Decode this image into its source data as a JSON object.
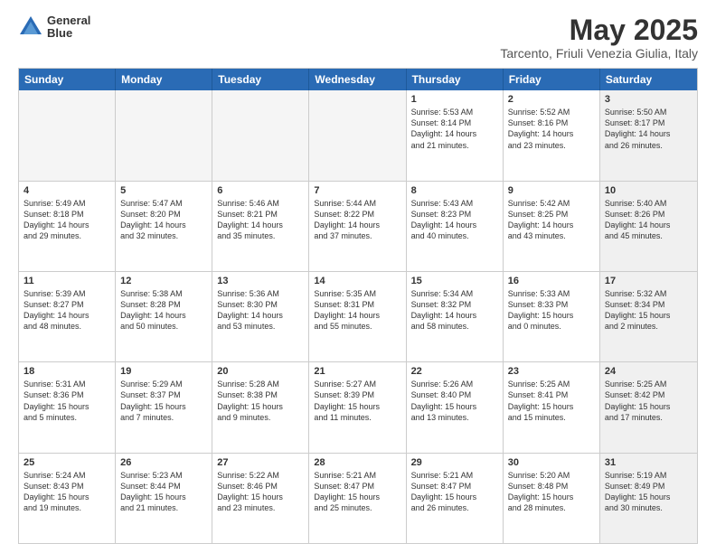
{
  "logo": {
    "line1": "General",
    "line2": "Blue"
  },
  "title": {
    "month": "May 2025",
    "location": "Tarcento, Friuli Venezia Giulia, Italy"
  },
  "header_days": [
    "Sunday",
    "Monday",
    "Tuesday",
    "Wednesday",
    "Thursday",
    "Friday",
    "Saturday"
  ],
  "weeks": [
    [
      {
        "day": "",
        "info": "",
        "empty": true
      },
      {
        "day": "",
        "info": "",
        "empty": true
      },
      {
        "day": "",
        "info": "",
        "empty": true
      },
      {
        "day": "",
        "info": "",
        "empty": true
      },
      {
        "day": "1",
        "info": "Sunrise: 5:53 AM\nSunset: 8:14 PM\nDaylight: 14 hours\nand 21 minutes.",
        "empty": false
      },
      {
        "day": "2",
        "info": "Sunrise: 5:52 AM\nSunset: 8:16 PM\nDaylight: 14 hours\nand 23 minutes.",
        "empty": false
      },
      {
        "day": "3",
        "info": "Sunrise: 5:50 AM\nSunset: 8:17 PM\nDaylight: 14 hours\nand 26 minutes.",
        "empty": false,
        "shaded": true
      }
    ],
    [
      {
        "day": "4",
        "info": "Sunrise: 5:49 AM\nSunset: 8:18 PM\nDaylight: 14 hours\nand 29 minutes.",
        "empty": false
      },
      {
        "day": "5",
        "info": "Sunrise: 5:47 AM\nSunset: 8:20 PM\nDaylight: 14 hours\nand 32 minutes.",
        "empty": false
      },
      {
        "day": "6",
        "info": "Sunrise: 5:46 AM\nSunset: 8:21 PM\nDaylight: 14 hours\nand 35 minutes.",
        "empty": false
      },
      {
        "day": "7",
        "info": "Sunrise: 5:44 AM\nSunset: 8:22 PM\nDaylight: 14 hours\nand 37 minutes.",
        "empty": false
      },
      {
        "day": "8",
        "info": "Sunrise: 5:43 AM\nSunset: 8:23 PM\nDaylight: 14 hours\nand 40 minutes.",
        "empty": false
      },
      {
        "day": "9",
        "info": "Sunrise: 5:42 AM\nSunset: 8:25 PM\nDaylight: 14 hours\nand 43 minutes.",
        "empty": false
      },
      {
        "day": "10",
        "info": "Sunrise: 5:40 AM\nSunset: 8:26 PM\nDaylight: 14 hours\nand 45 minutes.",
        "empty": false,
        "shaded": true
      }
    ],
    [
      {
        "day": "11",
        "info": "Sunrise: 5:39 AM\nSunset: 8:27 PM\nDaylight: 14 hours\nand 48 minutes.",
        "empty": false
      },
      {
        "day": "12",
        "info": "Sunrise: 5:38 AM\nSunset: 8:28 PM\nDaylight: 14 hours\nand 50 minutes.",
        "empty": false
      },
      {
        "day": "13",
        "info": "Sunrise: 5:36 AM\nSunset: 8:30 PM\nDaylight: 14 hours\nand 53 minutes.",
        "empty": false
      },
      {
        "day": "14",
        "info": "Sunrise: 5:35 AM\nSunset: 8:31 PM\nDaylight: 14 hours\nand 55 minutes.",
        "empty": false
      },
      {
        "day": "15",
        "info": "Sunrise: 5:34 AM\nSunset: 8:32 PM\nDaylight: 14 hours\nand 58 minutes.",
        "empty": false
      },
      {
        "day": "16",
        "info": "Sunrise: 5:33 AM\nSunset: 8:33 PM\nDaylight: 15 hours\nand 0 minutes.",
        "empty": false
      },
      {
        "day": "17",
        "info": "Sunrise: 5:32 AM\nSunset: 8:34 PM\nDaylight: 15 hours\nand 2 minutes.",
        "empty": false,
        "shaded": true
      }
    ],
    [
      {
        "day": "18",
        "info": "Sunrise: 5:31 AM\nSunset: 8:36 PM\nDaylight: 15 hours\nand 5 minutes.",
        "empty": false
      },
      {
        "day": "19",
        "info": "Sunrise: 5:29 AM\nSunset: 8:37 PM\nDaylight: 15 hours\nand 7 minutes.",
        "empty": false
      },
      {
        "day": "20",
        "info": "Sunrise: 5:28 AM\nSunset: 8:38 PM\nDaylight: 15 hours\nand 9 minutes.",
        "empty": false
      },
      {
        "day": "21",
        "info": "Sunrise: 5:27 AM\nSunset: 8:39 PM\nDaylight: 15 hours\nand 11 minutes.",
        "empty": false
      },
      {
        "day": "22",
        "info": "Sunrise: 5:26 AM\nSunset: 8:40 PM\nDaylight: 15 hours\nand 13 minutes.",
        "empty": false
      },
      {
        "day": "23",
        "info": "Sunrise: 5:25 AM\nSunset: 8:41 PM\nDaylight: 15 hours\nand 15 minutes.",
        "empty": false
      },
      {
        "day": "24",
        "info": "Sunrise: 5:25 AM\nSunset: 8:42 PM\nDaylight: 15 hours\nand 17 minutes.",
        "empty": false,
        "shaded": true
      }
    ],
    [
      {
        "day": "25",
        "info": "Sunrise: 5:24 AM\nSunset: 8:43 PM\nDaylight: 15 hours\nand 19 minutes.",
        "empty": false
      },
      {
        "day": "26",
        "info": "Sunrise: 5:23 AM\nSunset: 8:44 PM\nDaylight: 15 hours\nand 21 minutes.",
        "empty": false
      },
      {
        "day": "27",
        "info": "Sunrise: 5:22 AM\nSunset: 8:46 PM\nDaylight: 15 hours\nand 23 minutes.",
        "empty": false
      },
      {
        "day": "28",
        "info": "Sunrise: 5:21 AM\nSunset: 8:47 PM\nDaylight: 15 hours\nand 25 minutes.",
        "empty": false
      },
      {
        "day": "29",
        "info": "Sunrise: 5:21 AM\nSunset: 8:47 PM\nDaylight: 15 hours\nand 26 minutes.",
        "empty": false
      },
      {
        "day": "30",
        "info": "Sunrise: 5:20 AM\nSunset: 8:48 PM\nDaylight: 15 hours\nand 28 minutes.",
        "empty": false
      },
      {
        "day": "31",
        "info": "Sunrise: 5:19 AM\nSunset: 8:49 PM\nDaylight: 15 hours\nand 30 minutes.",
        "empty": false,
        "shaded": true
      }
    ]
  ]
}
